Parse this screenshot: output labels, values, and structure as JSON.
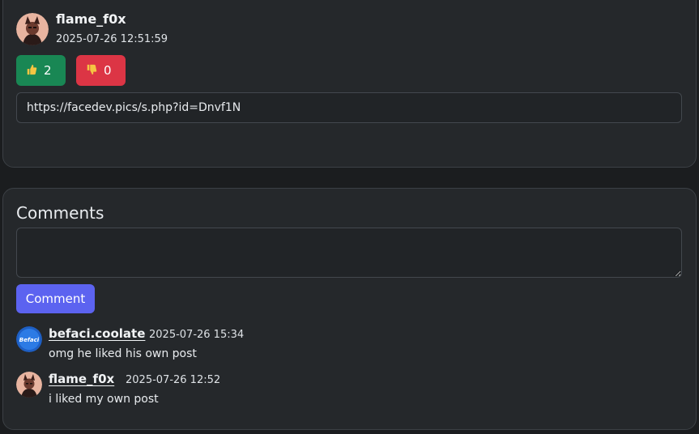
{
  "post": {
    "author": "flame_f0x",
    "timestamp": "2025-07-26 12:51:59",
    "likes": "2",
    "dislikes": "0",
    "like_icon": "thumbs-up-icon",
    "dislike_icon": "thumbs-down-icon",
    "url": "https://facedev.pics/s.php?id=Dnvf1N"
  },
  "comments_section": {
    "title": "Comments",
    "textarea_placeholder": "",
    "button_label": "Comment",
    "items": [
      {
        "author": "befaci.coolate",
        "timestamp": "2025-07-26 15:34",
        "text": "omg he liked his own post",
        "avatar_logo_text": "Befaci"
      },
      {
        "author": "flame_f0x",
        "timestamp": "2025-07-26 12:52",
        "text": "i liked my own post"
      }
    ]
  },
  "colors": {
    "background": "#1b1d1f",
    "card": "#25282b",
    "like": "#198754",
    "dislike": "#dc3545",
    "accent": "#5c63f0"
  }
}
